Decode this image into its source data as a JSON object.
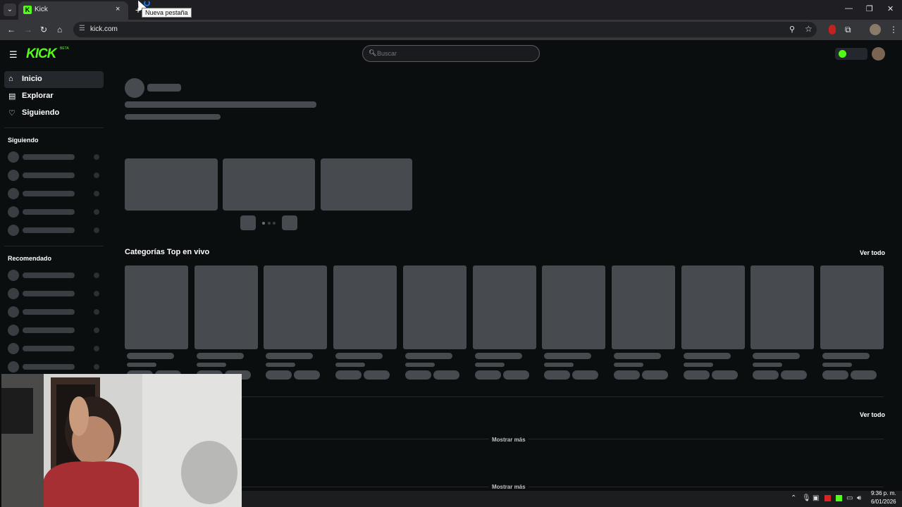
{
  "browser": {
    "tab_title": "Kick",
    "tab_favicon_letter": "K",
    "tab_close": "×",
    "newtab_tooltip": "Nueva pestaña",
    "url": "kick.com",
    "window_controls": [
      "—",
      "❐",
      "✕"
    ]
  },
  "header": {
    "logo": "KICK",
    "beta": "BETA",
    "search_placeholder": "Buscar"
  },
  "sidebar": {
    "nav": [
      {
        "label": "Inicio",
        "icon": "home-icon",
        "glyph": "⌂",
        "active": true
      },
      {
        "label": "Explorar",
        "icon": "explore-icon",
        "glyph": "▤",
        "active": false
      },
      {
        "label": "Siguiendo",
        "icon": "heart-icon",
        "glyph": "♡",
        "active": false
      }
    ],
    "following_heading": "Siguiendo",
    "recommended_heading": "Recomendado"
  },
  "main": {
    "top_categories_title": "Categorías Top en vivo",
    "view_all_1": "Ver todo",
    "view_all_2": "Ver todo",
    "show_more_1": "Mostrar más",
    "show_more_2": "Mostrar más"
  },
  "taskbar": {
    "time": "9:36 p. m.",
    "date": "6/01/2026"
  },
  "colors": {
    "brand": "#53fc18",
    "background": "#0b0e0f",
    "skeleton": "#474a4f"
  }
}
